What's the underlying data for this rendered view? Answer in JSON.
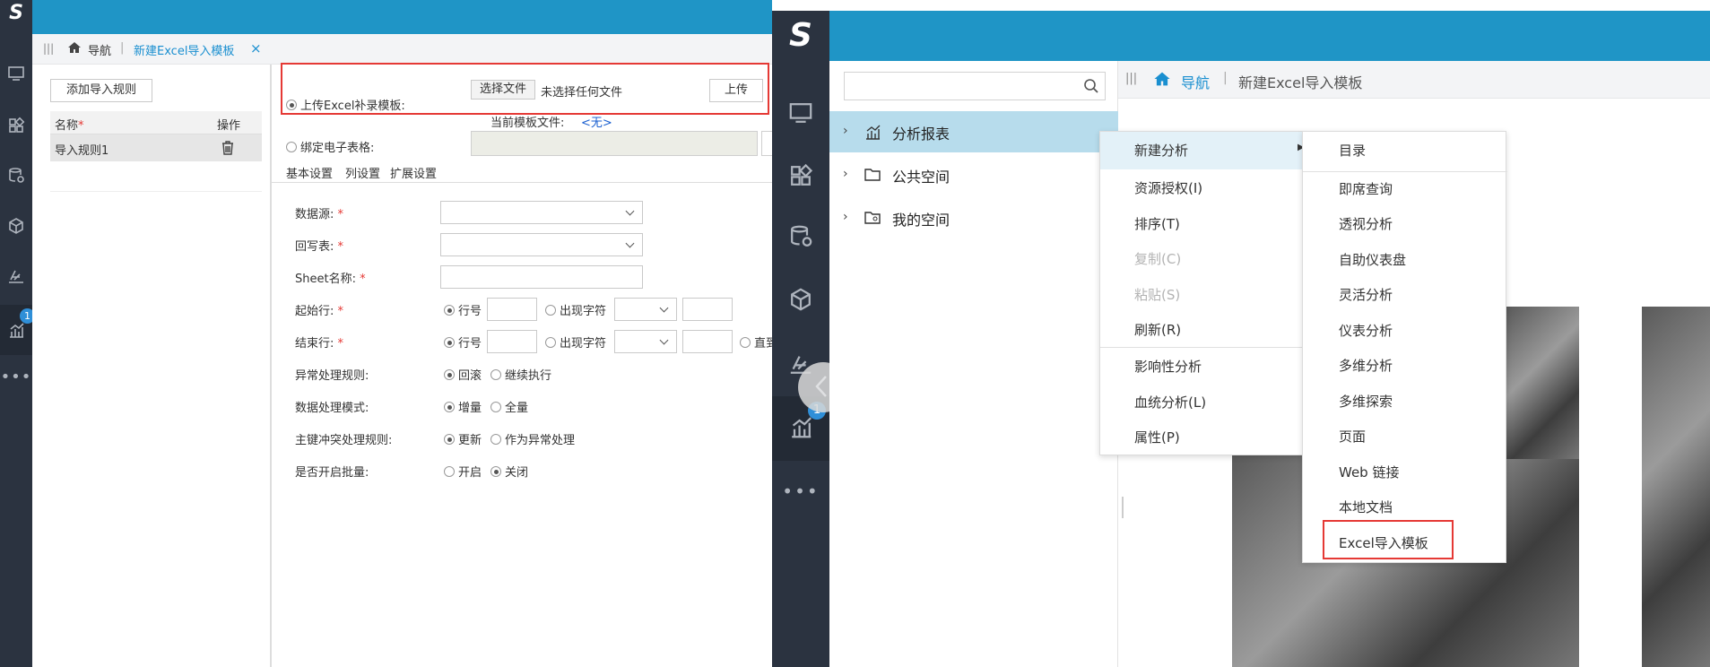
{
  "left": {
    "tabs": {
      "home": "导航",
      "active": "新建Excel导入模板",
      "close": "×"
    },
    "rules": {
      "add_button": "添加导入规则",
      "col_name": "名称",
      "col_name_req": "*",
      "col_op": "操作",
      "row1_name": "导入规则1"
    },
    "upload": {
      "radio_label": "上传Excel补录模板:",
      "choose_button": "选择文件",
      "no_file": "未选择任何文件",
      "upload_button": "上传",
      "current_label": "当前模板文件:",
      "current_value": "<无>"
    },
    "bind": {
      "radio_label": "绑定电子表格:"
    },
    "subtabs": [
      "基本设置",
      "列设置",
      "扩展设置"
    ],
    "form": {
      "datasource": "数据源:",
      "writeback": "回写表:",
      "sheet": "Sheet名称:",
      "start_row": "起始行:",
      "end_row": "结束行:",
      "row_num": "行号",
      "appear_char": "出现字符",
      "until": "直到",
      "exception_rule": "异常处理规则:",
      "rollback": "回滚",
      "continue": "继续执行",
      "data_mode": "数据处理模式:",
      "incremental": "增量",
      "full": "全量",
      "pk_conflict": "主键冲突处理规则:",
      "update": "更新",
      "as_exception": "作为异常处理",
      "batch": "是否开启批量:",
      "on": "开启",
      "off": "关闭",
      "req": "*"
    },
    "badge": "1"
  },
  "right": {
    "search": {
      "placeholder": ""
    },
    "breadcrumb": {
      "home": "导航",
      "sep": "|",
      "current": "新建Excel导入模板"
    },
    "tree": [
      "分析报表",
      "公共空间",
      "我的空间"
    ],
    "context_menu": [
      {
        "label": "新建分析",
        "disabled": false
      },
      {
        "label": "资源授权(I)",
        "disabled": false
      },
      {
        "label": "排序(T)",
        "disabled": false
      },
      {
        "label": "复制(C)",
        "disabled": true
      },
      {
        "label": "粘贴(S)",
        "disabled": true
      },
      {
        "label": "刷新(R)",
        "disabled": false
      },
      {
        "label": "影响性分析",
        "disabled": false
      },
      {
        "label": "血统分析(L)",
        "disabled": false
      },
      {
        "label": "属性(P)",
        "disabled": false
      }
    ],
    "submenu": [
      "目录",
      "即席查询",
      "透视分析",
      "自助仪表盘",
      "灵活分析",
      "仪表分析",
      "多维分析",
      "多维探索",
      "页面",
      "Web 链接",
      "本地文档",
      "Excel导入模板"
    ],
    "badge": "1"
  },
  "colors": {
    "sidebar": "#2b3340",
    "topbar": "#1f95c6",
    "accent": "#1a8fd0",
    "highlight": "#e53935"
  }
}
